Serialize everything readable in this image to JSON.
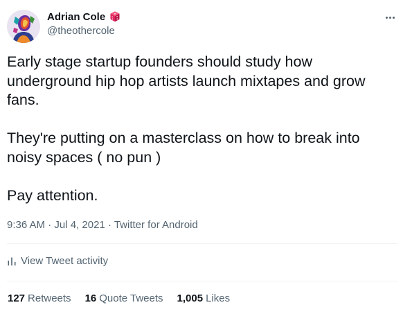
{
  "author": {
    "display_name": "Adrian Cole",
    "handle": "@theothercole",
    "avatar_icon": "portrait-avatar",
    "badge_icon": "dice-icon"
  },
  "tweet": {
    "paragraphs": [
      "Early stage startup founders should study how underground hip hop artists launch mixtapes and grow fans.",
      "They're putting on a masterclass on how to break into noisy spaces ( no pun )",
      "Pay attention."
    ],
    "time": "9:36 AM",
    "date": "Jul 4, 2021",
    "source": "Twitter for Android",
    "separator": " · "
  },
  "activity": {
    "label": "View Tweet activity",
    "icon": "bar-chart-icon"
  },
  "stats": {
    "retweets": {
      "count": "127",
      "label": "Retweets"
    },
    "quotes": {
      "count": "16",
      "label": "Quote Tweets"
    },
    "likes": {
      "count": "1,005",
      "label": "Likes"
    }
  },
  "colors": {
    "text_primary": "#0f1419",
    "text_secondary": "#536471",
    "divider": "#eff3f4",
    "dice_red": "#e0245e"
  }
}
